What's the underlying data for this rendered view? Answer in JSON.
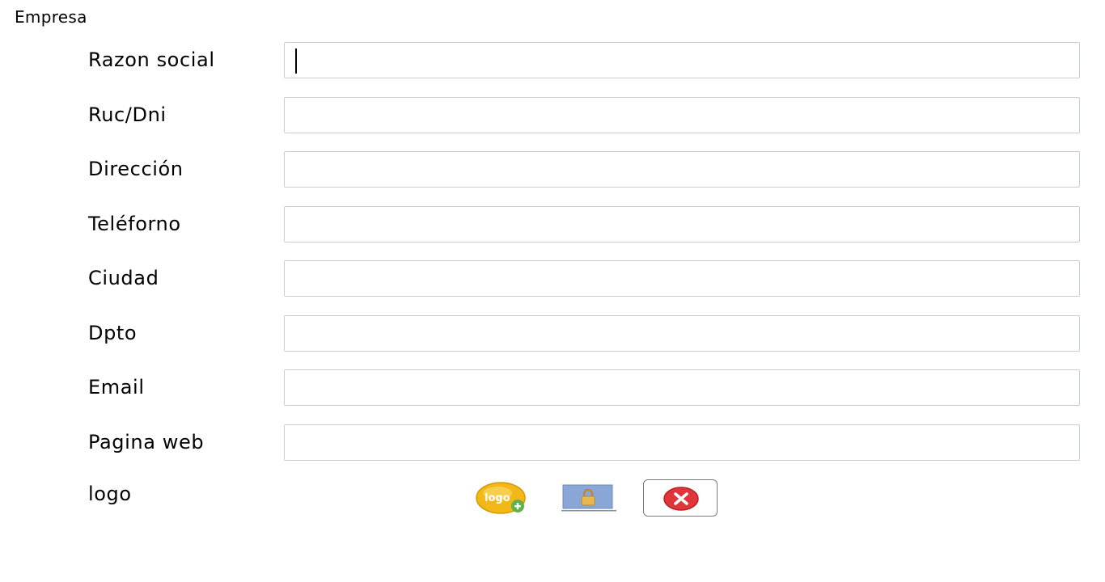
{
  "section": {
    "title": "Empresa"
  },
  "form": {
    "fields": [
      {
        "label": "Razon social",
        "value": ""
      },
      {
        "label": "Ruc/Dni",
        "value": ""
      },
      {
        "label": "Dirección",
        "value": ""
      },
      {
        "label": "Teléforno",
        "value": ""
      },
      {
        "label": "Ciudad",
        "value": ""
      },
      {
        "label": "Dpto",
        "value": ""
      },
      {
        "label": "Email",
        "value": ""
      },
      {
        "label": "Pagina web",
        "value": ""
      }
    ],
    "logo": {
      "label": "logo",
      "logo_badge_text": "logo",
      "icons": [
        "logo-add-icon",
        "lock-icon",
        "close-icon"
      ]
    }
  },
  "colors": {
    "field_border": "#c9ced3",
    "logo_badge": "#f2b817",
    "lock_frame": "#8aa6d6",
    "delete_red": "#e0363b"
  }
}
